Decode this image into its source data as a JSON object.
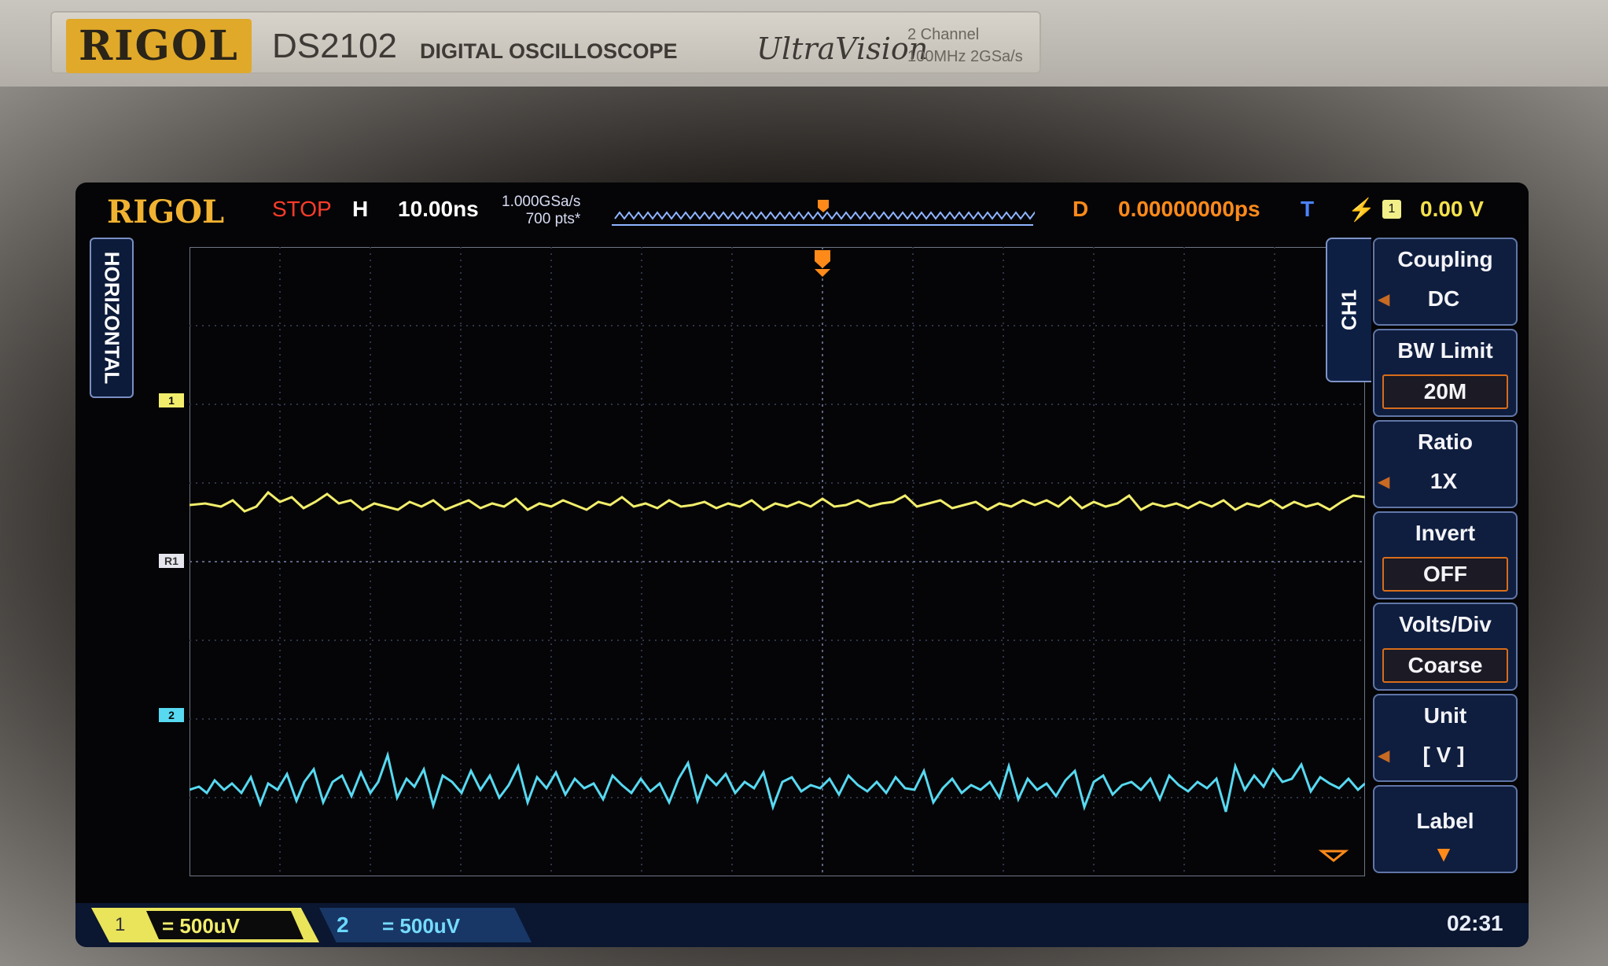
{
  "device": {
    "brand": "RIGOL",
    "model": "DS2102",
    "description": "DIGITAL OSCILLOSCOPE",
    "series": "UltraVision",
    "spec_channels": "2 Channel",
    "spec_perf": "100MHz 2GSa/s"
  },
  "topbar": {
    "logo": "RIGOL",
    "run_state": "STOP",
    "h_label": "H",
    "timebase": "10.00ns",
    "sample_rate": "1.000GSa/s",
    "memory_depth": "700 pts*",
    "d_label": "D",
    "delay": "0.00000000ps",
    "t_label": "T",
    "trigger_edge_icon": "rising-edge-icon",
    "trigger_source": "1",
    "trigger_level": "0.00 V"
  },
  "side_tab": {
    "label": "HORIZONTAL"
  },
  "markers": {
    "ch1": "1",
    "ref": "R1",
    "ch2": "2"
  },
  "menu": {
    "tab": "CH1",
    "items": [
      {
        "title": "Coupling",
        "value": "DC"
      },
      {
        "title": "BW Limit",
        "value": "20M"
      },
      {
        "title": "Ratio",
        "value": "1X"
      },
      {
        "title": "Invert",
        "value": "OFF"
      },
      {
        "title": "Volts/Div",
        "value": "Coarse"
      },
      {
        "title": "Unit",
        "value": "[ V ]"
      },
      {
        "title": "Label",
        "value": ""
      }
    ]
  },
  "bottombar": {
    "ch1_number": "1",
    "ch1_scale": "= 500uV",
    "ch2_number": "2",
    "ch2_scale": "=   500uV",
    "time": "02:31"
  },
  "colors": {
    "ch1": "#f2ee6c",
    "ch2": "#57d9f1",
    "accent_orange": "#ff8a1a",
    "stop_red": "#ff3b2a"
  }
}
